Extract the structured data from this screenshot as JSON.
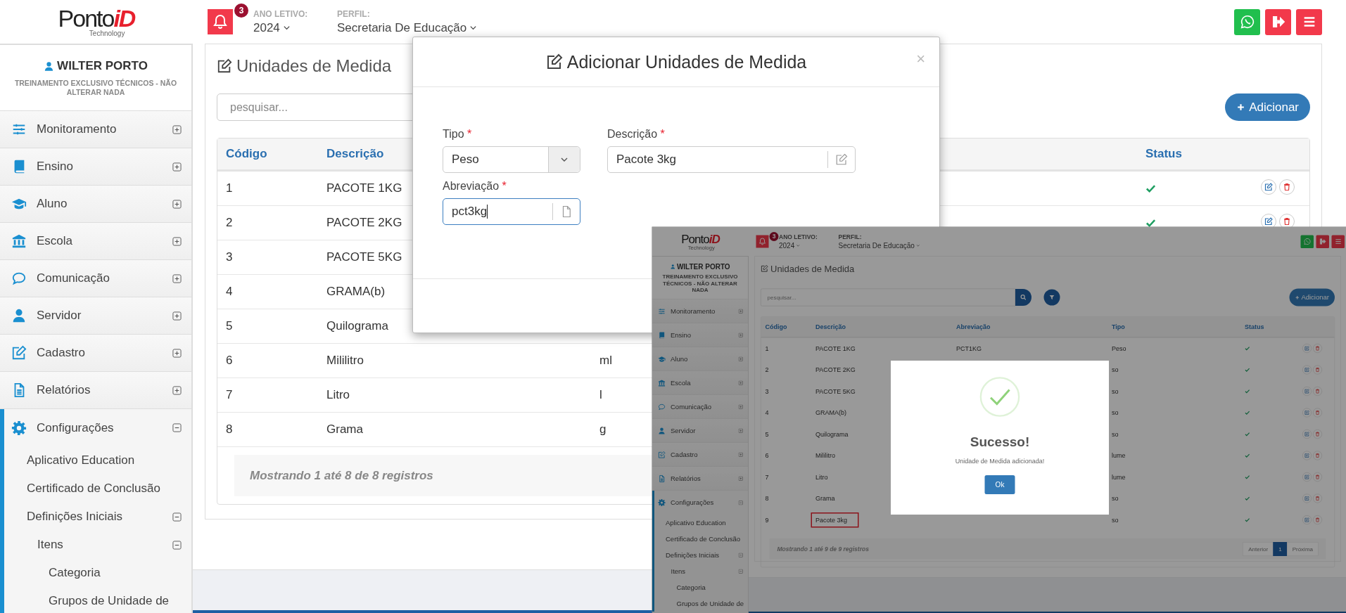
{
  "header": {
    "logo": {
      "name": "Ponto",
      "accent": "iD",
      "tagline": "Technology"
    },
    "notifications": {
      "count": "3"
    },
    "school_year": {
      "label": "ANO LETIVO:",
      "value": "2024"
    },
    "profile": {
      "label": "PERFIL:",
      "value": "Secretaria De Educação"
    }
  },
  "user": {
    "name": "WILTER PORTO",
    "organization": "TREINAMENTO EXCLUSIVO TÉCNICOS - NÃO ALTERAR NADA"
  },
  "sidebar": {
    "items": [
      {
        "label": "Monitoramento",
        "selected": false,
        "expanded": false
      },
      {
        "label": "Ensino",
        "selected": false,
        "expanded": false
      },
      {
        "label": "Aluno",
        "selected": false,
        "expanded": false
      },
      {
        "label": "Escola",
        "selected": false,
        "expanded": false
      },
      {
        "label": "Comunicação",
        "selected": false,
        "expanded": false
      },
      {
        "label": "Servidor",
        "selected": false,
        "expanded": false
      },
      {
        "label": "Cadastro",
        "selected": false,
        "expanded": false
      },
      {
        "label": "Relatórios",
        "selected": false,
        "expanded": false
      },
      {
        "label": "Configurações",
        "selected": true,
        "expanded": true,
        "children": [
          {
            "label": "Aplicativo Education"
          },
          {
            "label": "Certificado de Conclusão"
          },
          {
            "label": "Definições Iniciais",
            "expanded": true,
            "children": [
              {
                "label": "Itens",
                "expanded": true,
                "children": [
                  {
                    "label": "Categoria"
                  },
                  {
                    "label": "Grupos de Unidade de"
                  }
                ]
              }
            ]
          }
        ]
      }
    ]
  },
  "page": {
    "title": "Unidades de Medida",
    "search": {
      "placeholder": "pesquisar..."
    },
    "add_button": "Adicionar",
    "table": {
      "columns": {
        "codigo": "Código",
        "descricao": "Descrição",
        "status": "Status"
      },
      "rows": [
        {
          "codigo": "1",
          "descricao": "PACOTE 1KG",
          "active": true,
          "actions": true
        },
        {
          "codigo": "2",
          "descricao": "PACOTE 2KG",
          "active": true,
          "actions": true
        },
        {
          "codigo": "3",
          "descricao": "PACOTE 5KG"
        },
        {
          "codigo": "4",
          "descricao": "GRAMA(b)"
        },
        {
          "codigo": "5",
          "descricao": "Quilograma"
        },
        {
          "codigo": "6",
          "descricao": "Mililitro",
          "abreviacao": "ml"
        },
        {
          "codigo": "7",
          "descricao": "Litro",
          "abreviacao": "l"
        },
        {
          "codigo": "8",
          "descricao": "Grama",
          "abreviacao": "g"
        }
      ],
      "footer": "Mostrando **1** até **8** de **8** registros"
    }
  },
  "dialog": {
    "title": "Adicionar Unidades de Medida",
    "close": "×",
    "fields": [
      {
        "kind": "select",
        "label": "Tipo",
        "required_mark": "*",
        "value": "Peso",
        "focused": false
      },
      {
        "kind": "text",
        "label": "Descrição",
        "required_mark": "*",
        "value": "Pacote 3kg",
        "focused": false
      },
      {
        "kind": "text",
        "label": "Abreviação",
        "required_mark": "*",
        "value": "pct3kg",
        "focused": true
      }
    ]
  },
  "inset": {
    "header": {
      "logo": {
        "name": "Ponto",
        "accent": "iD",
        "tagline": "Technology"
      },
      "notifications": {
        "count": "3"
      },
      "school_year": {
        "label": "ANO LETIVO:",
        "value": "2024"
      },
      "profile": {
        "label": "PERFIL:",
        "value": "Secretaria De Educação"
      }
    },
    "user": {
      "name": "WILTER PORTO",
      "organization": "TREINAMENTO EXCLUSIVO TÉCNICOS - NÃO ALTERAR NADA"
    },
    "sidebar": {
      "items": [
        {
          "label": "Monitoramento",
          "selected": false,
          "expanded": false
        },
        {
          "label": "Ensino",
          "selected": false,
          "expanded": false
        },
        {
          "label": "Aluno",
          "selected": false,
          "expanded": false
        },
        {
          "label": "Escola",
          "selected": false,
          "expanded": false
        },
        {
          "label": "Comunicação",
          "selected": false,
          "expanded": false
        },
        {
          "label": "Servidor",
          "selected": false,
          "expanded": false
        },
        {
          "label": "Cadastro",
          "selected": false,
          "expanded": false
        },
        {
          "label": "Relatórios",
          "selected": false,
          "expanded": false
        },
        {
          "label": "Configurações",
          "selected": true,
          "expanded": true,
          "children": [
            {
              "label": "Aplicativo Education"
            },
            {
              "label": "Certificado de Conclusão"
            },
            {
              "label": "Definições Iniciais",
              "expanded": true,
              "children": [
                {
                  "label": "Itens",
                  "expanded": true,
                  "children": [
                    {
                      "label": "Categoria"
                    },
                    {
                      "label": "Grupos de Unidade de"
                    }
                  ]
                }
              ]
            }
          ]
        }
      ]
    },
    "page": {
      "title": "Unidades de Medida",
      "search": {
        "placeholder": "pesquisar..."
      },
      "add_button": "Adicionar",
      "table": {
        "columns": {
          "codigo": "Código",
          "descricao": "Descrição",
          "abreviacao": "Abreviação",
          "tipo": "Tipo",
          "status": "Status"
        },
        "rows": [
          {
            "codigo": "1",
            "descricao": "PACOTE 1KG",
            "abreviacao": "PCT1KG",
            "tipo": "Peso",
            "active": true,
            "actions": true,
            "highlighted": false
          },
          {
            "codigo": "2",
            "descricao": "PACOTE 2KG",
            "tipo": "so",
            "active": true,
            "actions": true,
            "highlighted": false
          },
          {
            "codigo": "3",
            "descricao": "PACOTE 5KG",
            "tipo": "so",
            "active": true,
            "actions": true,
            "highlighted": false
          },
          {
            "codigo": "4",
            "descricao": "GRAMA(b)",
            "tipo": "so",
            "active": true,
            "actions": true,
            "highlighted": false
          },
          {
            "codigo": "5",
            "descricao": "Quilograma",
            "tipo": "so",
            "active": true,
            "actions": true,
            "highlighted": false
          },
          {
            "codigo": "6",
            "descricao": "Mililitro",
            "tipo": "lume",
            "active": true,
            "actions": true,
            "highlighted": false
          },
          {
            "codigo": "7",
            "descricao": "Litro",
            "tipo": "lume",
            "active": true,
            "actions": true,
            "highlighted": false
          },
          {
            "codigo": "8",
            "descricao": "Grama",
            "tipo": "so",
            "active": true,
            "actions": true,
            "highlighted": false
          },
          {
            "codigo": "9",
            "descricao": "Pacote 3kg",
            "tipo": "so",
            "active": true,
            "actions": true,
            "highlighted": true
          }
        ],
        "footer": "Mostrando **1** até **9** de **9** registros",
        "pagination": [
          {
            "label": "Anterior",
            "selected": false
          },
          {
            "label": "1",
            "selected": true
          },
          {
            "label": "Próxima",
            "selected": false
          }
        ]
      }
    },
    "success_dialog": {
      "title": "Sucesso!",
      "message": "Unidade de Medida adicionada!",
      "button": "Ok"
    }
  }
}
